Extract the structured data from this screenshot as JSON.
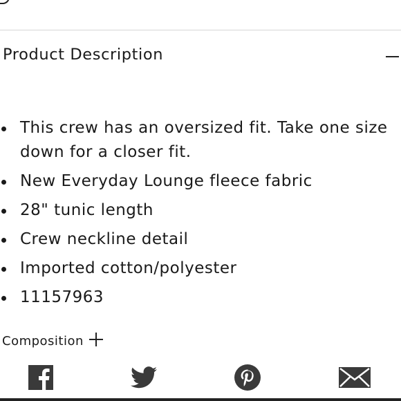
{
  "product_description": {
    "title": "Product Description",
    "expanded": true,
    "items": [
      "This crew has an oversized fit. Take one size down for a closer fit.",
      "New Everyday Lounge fleece fabric",
      "28\" tunic length",
      "Crew neckline detail",
      "Imported cotton/polyester",
      "11157963"
    ]
  },
  "composition": {
    "label": "Composition",
    "expanded": false
  },
  "share": {
    "icons": [
      "facebook-icon",
      "twitter-icon",
      "pinterest-icon",
      "email-icon"
    ],
    "icon_color": "#3a3a3a"
  },
  "colors": {
    "text": "#1a1a1a",
    "divider": "#d6d6d6",
    "background": "#ffffff"
  }
}
